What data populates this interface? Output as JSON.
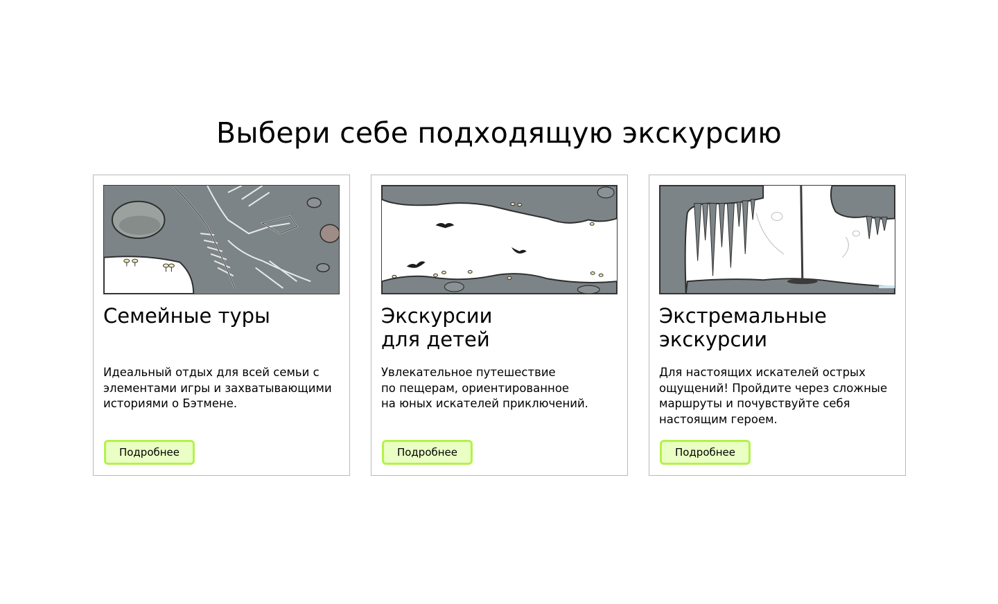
{
  "page": {
    "title": "Выбери себе подходящую экскурсию"
  },
  "colors": {
    "button_border": "#b3f24a",
    "button_fill": "#eaffc4",
    "rock": "#7d8488",
    "rock_dark": "#3b3b3b",
    "card_border": "#b9b9b9"
  },
  "cards": [
    {
      "title": "Семейные туры",
      "text": "Идеальный отдых для всей семьи с\nэлементами игры и захватывающими\nисториями о Бэтмене.",
      "button_label": "Подробнее",
      "image_icon": "dinosaur-fossil-cave-illustration"
    },
    {
      "title": "Экскурсии\nдля детей",
      "text": "Увлекательное путешествие\nпо пещерам, ориентированное\nна юных искателей приключений.",
      "button_label": "Подробнее",
      "image_icon": "bats-cave-illustration"
    },
    {
      "title": "Экстремальные\nэкскурсии",
      "text": "Для настоящих искателей острых\nощущений! Пройдите через сложные\nмаршруты и почувствуйте себя\nнастоящим героем.",
      "button_label": "Подробнее",
      "image_icon": "stalactites-rope-cave-illustration"
    }
  ]
}
